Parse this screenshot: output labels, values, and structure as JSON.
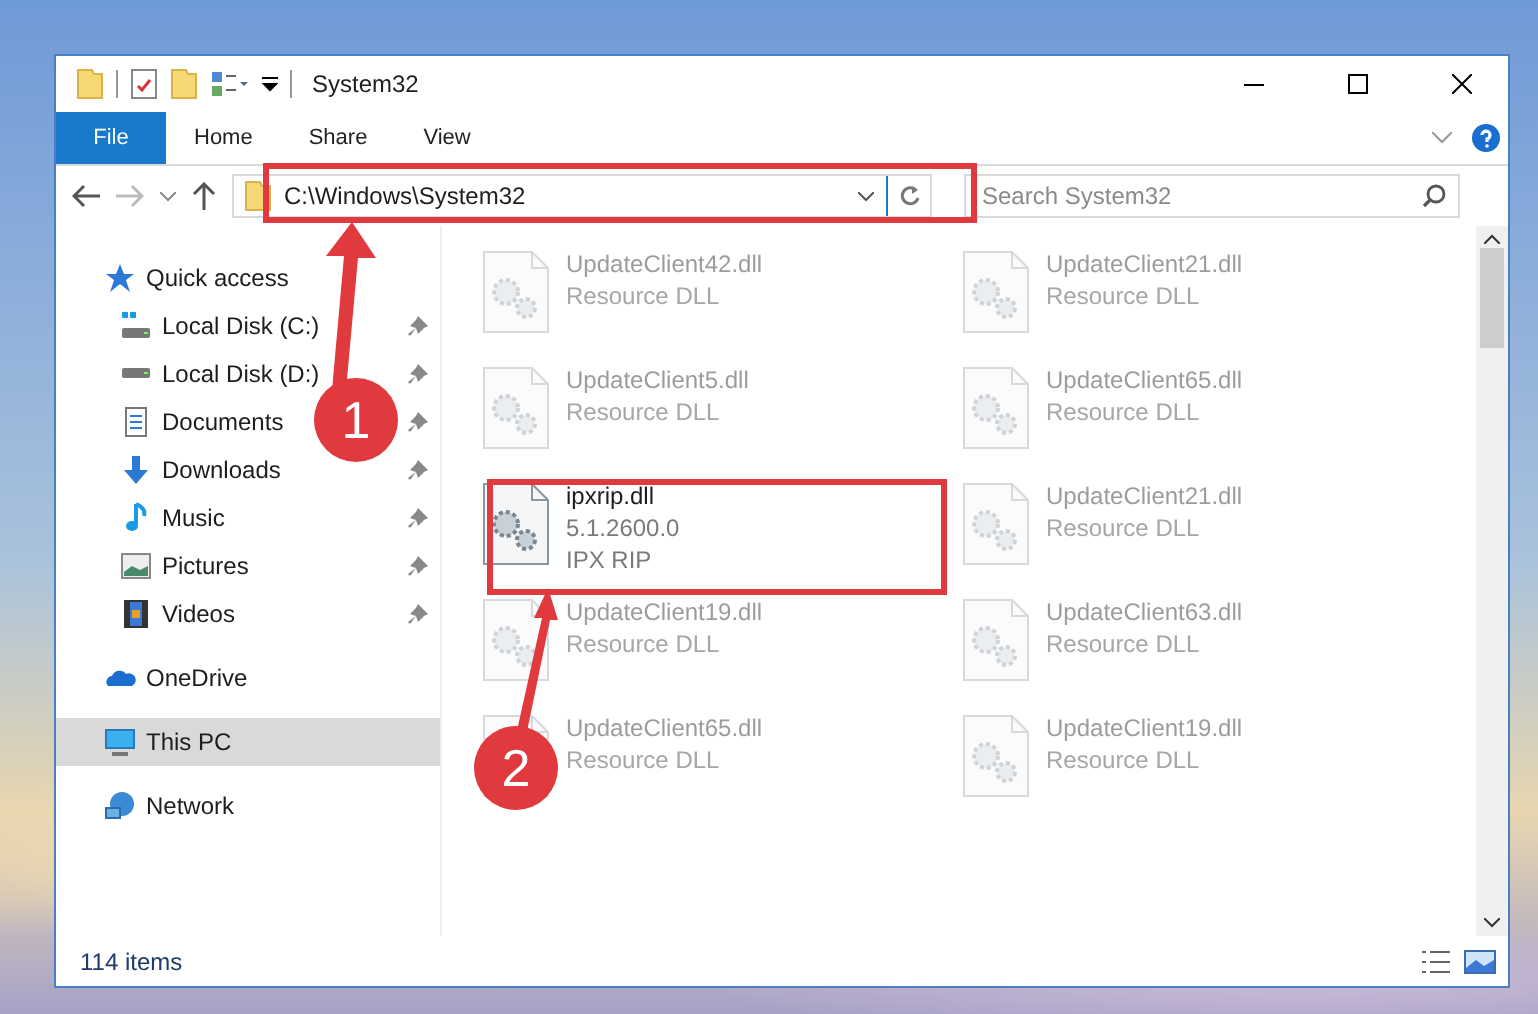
{
  "window": {
    "title": "System32"
  },
  "ribbon_tabs": [
    {
      "label": "File",
      "kind": "file"
    },
    {
      "label": "Home",
      "kind": "tab"
    },
    {
      "label": "Share",
      "kind": "tab"
    },
    {
      "label": "View",
      "kind": "tab"
    }
  ],
  "address_bar": {
    "path": "C:\\Windows\\System32"
  },
  "search": {
    "placeholder": "Search System32"
  },
  "sidebar": {
    "items": [
      {
        "label": "Quick access",
        "selected": false,
        "children": [
          {
            "label": "Local Disk (C:)",
            "pinned": true
          },
          {
            "label": "Local Disk (D:)",
            "pinned": true
          },
          {
            "label": "Documents",
            "pinned": true
          },
          {
            "label": "Downloads",
            "pinned": true
          },
          {
            "label": "Music",
            "pinned": true
          },
          {
            "label": "Pictures",
            "pinned": true
          },
          {
            "label": "Videos",
            "pinned": true
          }
        ]
      },
      {
        "label": "OneDrive",
        "selected": false
      },
      {
        "label": "This PC",
        "selected": true
      },
      {
        "label": "Network",
        "selected": false
      }
    ]
  },
  "files": [
    {
      "name": "UpdateClient42.dll",
      "lines": [
        "Resource DLL"
      ],
      "highlighted": false
    },
    {
      "name": "UpdateClient21.dll",
      "lines": [
        "Resource DLL"
      ],
      "highlighted": false
    },
    {
      "name": "UpdateClient5.dll",
      "lines": [
        "Resource DLL"
      ],
      "highlighted": false
    },
    {
      "name": "UpdateClient65.dll",
      "lines": [
        "Resource DLL"
      ],
      "highlighted": false
    },
    {
      "name": "ipxrip.dll",
      "lines": [
        "5.1.2600.0",
        "IPX RIP"
      ],
      "highlighted": true
    },
    {
      "name": "UpdateClient21.dll",
      "lines": [
        "Resource DLL"
      ],
      "highlighted": false
    },
    {
      "name": "UpdateClient19.dll",
      "lines": [
        "Resource DLL"
      ],
      "highlighted": false
    },
    {
      "name": "UpdateClient63.dll",
      "lines": [
        "Resource DLL"
      ],
      "highlighted": false
    },
    {
      "name": "UpdateClient65.dll",
      "lines": [
        "Resource DLL"
      ],
      "highlighted": false
    },
    {
      "name": "UpdateClient19.dll",
      "lines": [
        "Resource DLL"
      ],
      "highlighted": false
    }
  ],
  "status_bar": {
    "count": "114 items"
  },
  "annotations": [
    {
      "label": "1"
    },
    {
      "label": "2"
    }
  ]
}
